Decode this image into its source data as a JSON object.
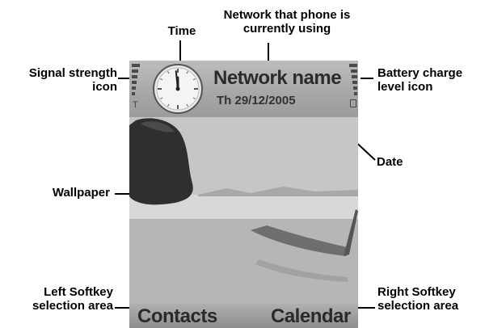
{
  "annotations": {
    "time": "Time",
    "network_line1": "Network that phone is",
    "network_line2": "currently using",
    "signal_line1": "Signal strength",
    "signal_line2": "icon",
    "battery_line1": "Battery charge",
    "battery_line2": "level icon",
    "date": "Date",
    "wallpaper": "Wallpaper",
    "left_softkey_line1": "Left Softkey",
    "left_softkey_line2": "selection area",
    "right_softkey_line1": "Right Softkey",
    "right_softkey_line2": "selection area"
  },
  "screen": {
    "network_name": "Network name",
    "date": "Th 29/12/2005",
    "left_softkey": "Contacts",
    "right_softkey": "Calendar",
    "clock": {
      "hour": 11,
      "minute": 59
    }
  },
  "colors": {
    "status_bar": "#a6a6a6",
    "softkey_bar": "#8e8e8e",
    "text_dark": "#2b2b2b"
  },
  "icons": {
    "signal": "signal-strength-icon",
    "battery": "battery-level-icon",
    "clock": "analog-clock-icon"
  }
}
